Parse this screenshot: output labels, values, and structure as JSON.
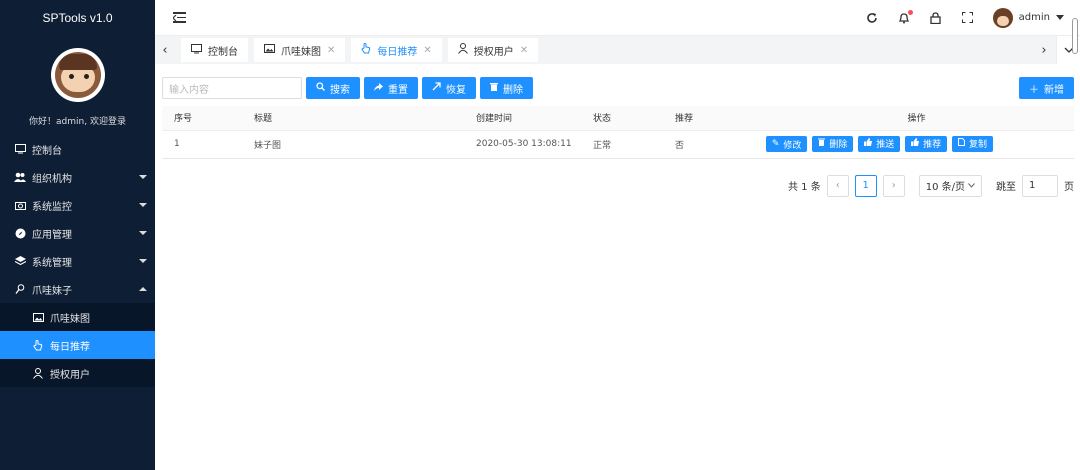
{
  "app": {
    "title": "SPTools v1.0",
    "welcome": "你好！admin, 欢迎登录"
  },
  "sidebar": {
    "items": [
      {
        "label": "控制台",
        "icon": "monitor-icon"
      },
      {
        "label": "组织机构",
        "icon": "users-icon"
      },
      {
        "label": "系统监控",
        "icon": "camera-icon"
      },
      {
        "label": "应用管理",
        "icon": "compass-icon"
      },
      {
        "label": "系统管理",
        "icon": "layers-icon"
      },
      {
        "label": "爪哇妹子",
        "icon": "key-icon"
      }
    ],
    "submenu": [
      {
        "label": "爪哇妹图",
        "icon": "image-icon"
      },
      {
        "label": "每日推荐",
        "icon": "hand-icon"
      },
      {
        "label": "授权用户",
        "icon": "user-icon"
      }
    ]
  },
  "topbar": {
    "user": "admin"
  },
  "tabs": [
    {
      "label": "控制台"
    },
    {
      "label": "爪哇妹图"
    },
    {
      "label": "每日推荐"
    },
    {
      "label": "授权用户"
    }
  ],
  "toolbar": {
    "search_placeholder": "输入内容",
    "search": "搜索",
    "reset": "重置",
    "restore": "恢复",
    "delete": "删除",
    "add": "新增"
  },
  "table": {
    "headers": [
      "序号",
      "标题",
      "创建时间",
      "状态",
      "推荐",
      "操作"
    ],
    "rows": [
      {
        "index": "1",
        "title": "妹子图",
        "created": "2020-05-30 13:08:11",
        "status": "正常",
        "recommend": "否"
      }
    ],
    "actions": [
      "修改",
      "删除",
      "推送",
      "推荐",
      "复制"
    ]
  },
  "pager": {
    "total": "共 1 条",
    "page": "1",
    "size": "10 条/页",
    "jump_label": "跳至",
    "jump_value": "1",
    "page_unit": "页"
  },
  "colors": {
    "primary": "#1e90ff",
    "sidebar": "#0e1e35"
  }
}
